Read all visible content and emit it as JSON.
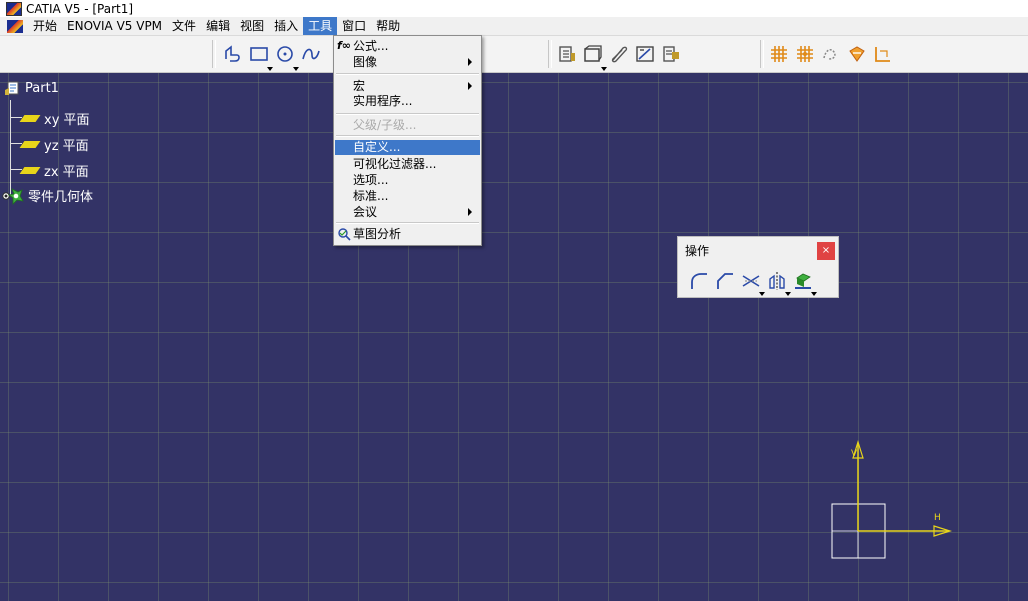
{
  "window": {
    "title": "CATIA V5 - [Part1]"
  },
  "menubar": {
    "items": [
      "开始",
      "ENOVIA V5 VPM",
      "文件",
      "编辑",
      "视图",
      "插入",
      "工具",
      "窗口",
      "帮助"
    ],
    "active": "工具"
  },
  "tools_menu": {
    "items": [
      {
        "label": "公式...",
        "icon": "formula-fx-icon",
        "submenu": false
      },
      {
        "label": "图像",
        "submenu": true
      },
      {
        "label": "宏",
        "submenu": true
      },
      {
        "label": "实用程序...",
        "submenu": false
      },
      {
        "label": "父级/子级...",
        "disabled": true
      },
      {
        "label": "自定义...",
        "highlighted": true
      },
      {
        "label": "可视化过滤器...",
        "submenu": false
      },
      {
        "label": "选项...",
        "submenu": false
      },
      {
        "label": "标准...",
        "submenu": false
      },
      {
        "label": "会议",
        "submenu": true
      },
      {
        "label": "草图分析",
        "icon": "sketch-analysis-icon",
        "submenu": false
      }
    ]
  },
  "tree": {
    "root": "Part1",
    "nodes": [
      "xy 平面",
      "yz 平面",
      "zx 平面"
    ],
    "body": "零件几何体"
  },
  "operation_toolbar": {
    "title": "操作",
    "close": "×",
    "icons": [
      "corner-icon",
      "chamfer-icon",
      "trim-icon",
      "mirror-icon",
      "project-3d-elements-icon"
    ]
  },
  "axis": {
    "h_label": "H",
    "v_label": "V"
  },
  "colors": {
    "workspace_bg": "#333366",
    "grid": "#788c6e",
    "highlight": "#3e78c9",
    "close_button": "#e04343",
    "axis_yellow": "#e8d51a"
  }
}
